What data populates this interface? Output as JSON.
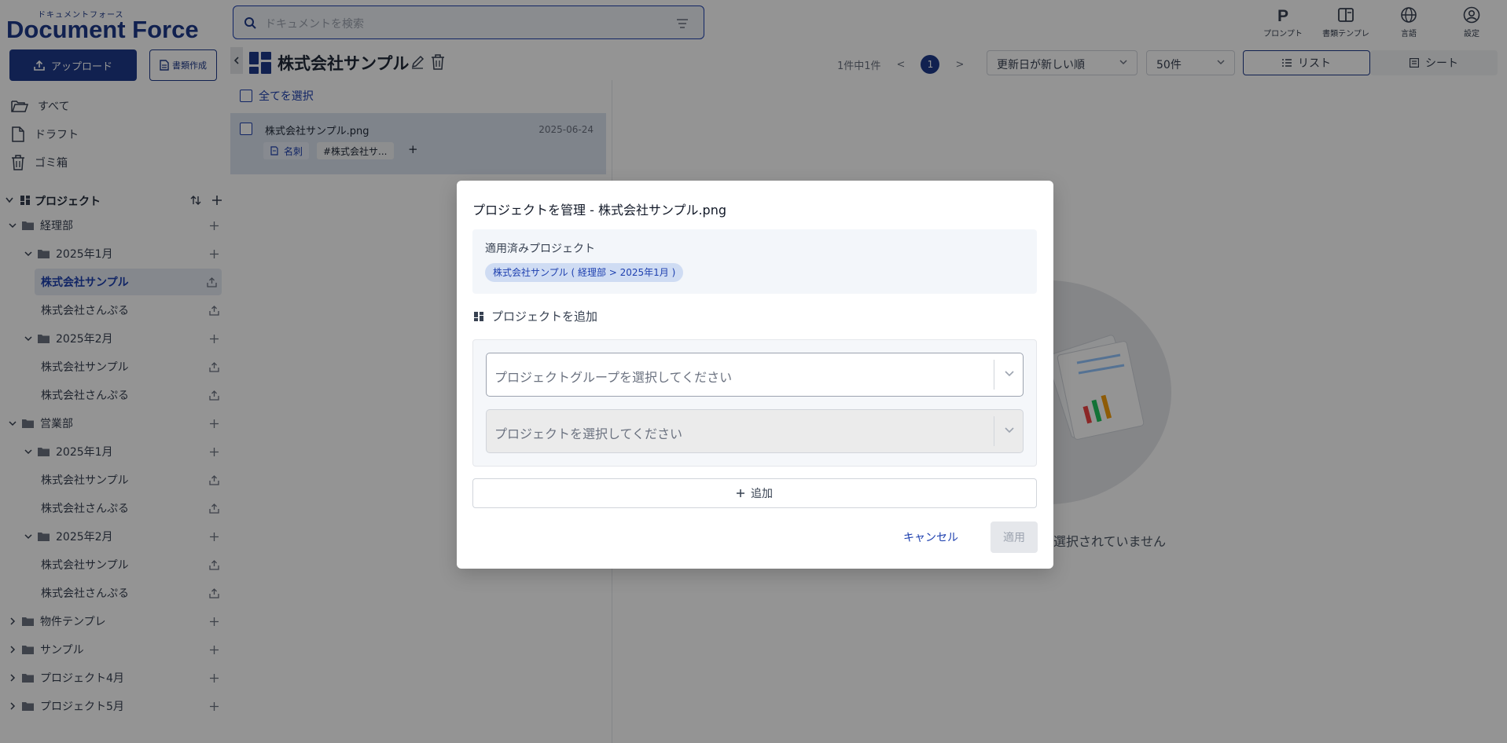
{
  "brand": {
    "small": "ドキュメントフォース",
    "main": "Document Force"
  },
  "search": {
    "placeholder": "ドキュメントを検索"
  },
  "top_icons": [
    {
      "label": "プロンプト",
      "icon": "prompt-icon"
    },
    {
      "label": "書類テンプレ",
      "icon": "template-icon"
    },
    {
      "label": "言語",
      "icon": "globe-icon"
    },
    {
      "label": "設定",
      "icon": "user-circle-icon"
    }
  ],
  "sidebar": {
    "upload_label": "アップロード",
    "create_doc_label": "書類作成",
    "nav": [
      {
        "label": "すべて",
        "icon": "folder-open-icon"
      },
      {
        "label": "ドラフト",
        "icon": "file-icon"
      },
      {
        "label": "ゴミ箱",
        "icon": "trash-icon"
      }
    ],
    "projects_label": "プロジェクト",
    "tree": [
      {
        "label": "経理部",
        "level": 0,
        "kind": "folder",
        "expanded": true
      },
      {
        "label": "2025年1月",
        "level": 1,
        "kind": "folder",
        "expanded": true
      },
      {
        "label": "株式会社サンプル",
        "level": 2,
        "kind": "project",
        "active": true
      },
      {
        "label": "株式会社さんぷる",
        "level": 2,
        "kind": "project"
      },
      {
        "label": "2025年2月",
        "level": 1,
        "kind": "folder",
        "expanded": true
      },
      {
        "label": "株式会社サンプル",
        "level": 2,
        "kind": "project"
      },
      {
        "label": "株式会社さんぷる",
        "level": 2,
        "kind": "project"
      },
      {
        "label": "営業部",
        "level": 0,
        "kind": "folder",
        "expanded": true
      },
      {
        "label": "2025年1月",
        "level": 1,
        "kind": "folder",
        "expanded": true
      },
      {
        "label": "株式会社サンプル",
        "level": 2,
        "kind": "project"
      },
      {
        "label": "株式会社さんぷる",
        "level": 2,
        "kind": "project"
      },
      {
        "label": "2025年2月",
        "level": 1,
        "kind": "folder",
        "expanded": true
      },
      {
        "label": "株式会社サンプル",
        "level": 2,
        "kind": "project"
      },
      {
        "label": "株式会社さんぷる",
        "level": 2,
        "kind": "project"
      },
      {
        "label": "物件テンプレ",
        "level": 0,
        "kind": "folder",
        "expanded": false
      },
      {
        "label": "サンプル",
        "level": 0,
        "kind": "folder",
        "expanded": false
      },
      {
        "label": "プロジェクト4月",
        "level": 0,
        "kind": "folder",
        "expanded": false
      },
      {
        "label": "プロジェクト5月",
        "level": 0,
        "kind": "folder",
        "expanded": false
      }
    ]
  },
  "header": {
    "title": "株式会社サンプル",
    "pager_text": "1件中1件",
    "prev": "<",
    "current_page": "1",
    "next": ">",
    "sort": "更新日が新しい順",
    "per_page": "50件",
    "view_list": "リスト",
    "view_sheet": "シート"
  },
  "list": {
    "select_all": "全てを選択",
    "items": [
      {
        "name": "株式会社サンプル.png",
        "date": "2025-06-24",
        "tag_type": "名刺",
        "tag_project": "#株式会社サ...",
        "add": "+"
      }
    ]
  },
  "empty": {
    "text": "選択されていません"
  },
  "modal": {
    "title": "プロジェクトを管理 - 株式会社サンプル.png",
    "applied_label": "適用済みプロジェクト",
    "applied_chip": "株式会社サンプル ( 経理部 > 2025年1月 )",
    "add_heading": "プロジェクトを追加",
    "group_placeholder": "プロジェクトグループを選択してください",
    "project_placeholder": "プロジェクトを選択してください",
    "add_button": "追加",
    "cancel": "キャンセル",
    "apply": "適用"
  },
  "colors": {
    "primary": "#1e3a8a",
    "accent": "#1e40af",
    "active_bg": "#e5eaf3"
  }
}
